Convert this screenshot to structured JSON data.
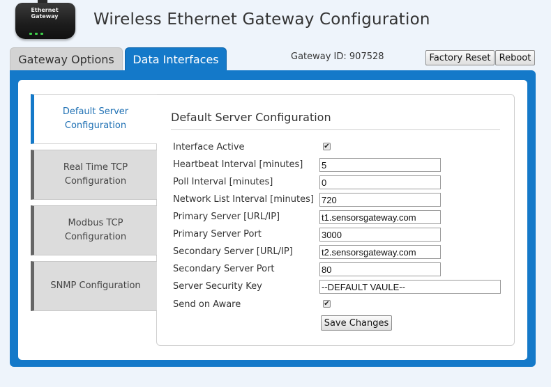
{
  "header": {
    "logo_text": "Ethernet Gateway",
    "title": "Wireless Ethernet Gateway Configuration"
  },
  "tabs": [
    {
      "label": "Gateway Options",
      "active": false
    },
    {
      "label": "Data Interfaces",
      "active": true
    }
  ],
  "gateway_id": "Gateway ID: 907528",
  "toolbar": {
    "factory_reset_label": "Factory Reset",
    "reboot_label": "Reboot"
  },
  "sidebar": {
    "items": [
      {
        "label": "Default Server Configuration",
        "active": true
      },
      {
        "label": "Real Time TCP Configuration",
        "active": false
      },
      {
        "label": "Modbus TCP Configuration",
        "active": false
      },
      {
        "label": "SNMP Configuration",
        "active": false
      }
    ]
  },
  "panel": {
    "title": "Default Server Configuration",
    "fields": {
      "interface_active": {
        "label": "Interface Active",
        "checked": true
      },
      "heartbeat": {
        "label": "Heartbeat Interval [minutes]",
        "value": "5"
      },
      "poll": {
        "label": "Poll Interval [minutes]",
        "value": "0"
      },
      "network_list": {
        "label": "Network List Interval [minutes]",
        "value": "720"
      },
      "primary_server": {
        "label": "Primary Server [URL/IP]",
        "value": "t1.sensorsgateway.com"
      },
      "primary_port": {
        "label": "Primary Server Port",
        "value": "3000"
      },
      "secondary_server": {
        "label": "Secondary Server [URL/IP]",
        "value": "t2.sensorsgateway.com"
      },
      "secondary_port": {
        "label": "Secondary Server Port",
        "value": "80"
      },
      "security_key": {
        "label": "Server Security Key",
        "value": "--DEFAULT VAULE--"
      },
      "send_on_aware": {
        "label": "Send on Aware",
        "checked": true
      }
    },
    "save_label": "Save Changes"
  },
  "colors": {
    "accent": "#1479c9",
    "inactive_tab": "#d3d3d3",
    "sidebar_inactive": "#dcdcdc"
  }
}
